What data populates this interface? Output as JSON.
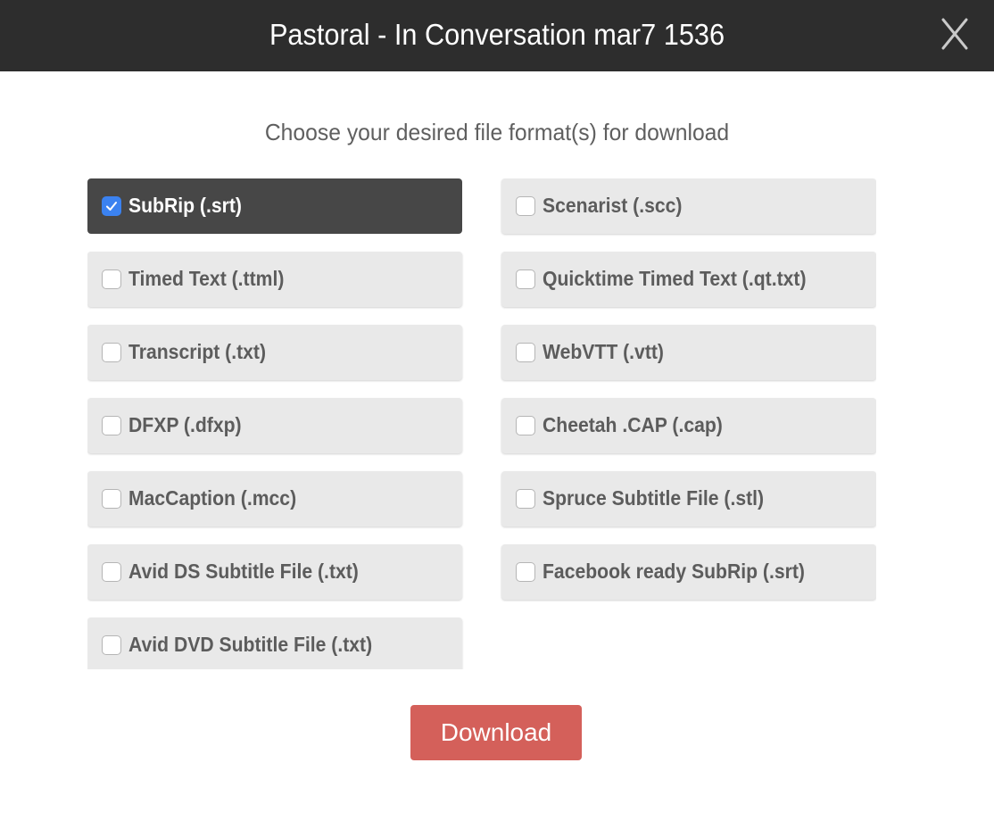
{
  "dialog": {
    "title": "Pastoral - In Conversation mar7 1536",
    "close_icon": "close-x-icon",
    "subtitle": "Choose your desired file format(s) for download"
  },
  "formats": [
    {
      "label": "SubRip (.srt)",
      "checked": true
    },
    {
      "label": "Scenarist (.scc)",
      "checked": false
    },
    {
      "label": "Timed Text (.ttml)",
      "checked": false
    },
    {
      "label": "Quicktime Timed Text (.qt.txt)",
      "checked": false
    },
    {
      "label": "Transcript (.txt)",
      "checked": false
    },
    {
      "label": "WebVTT (.vtt)",
      "checked": false
    },
    {
      "label": "DFXP (.dfxp)",
      "checked": false
    },
    {
      "label": "Cheetah .CAP (.cap)",
      "checked": false
    },
    {
      "label": "MacCaption (.mcc)",
      "checked": false
    },
    {
      "label": "Spruce Subtitle File (.stl)",
      "checked": false
    },
    {
      "label": "Avid DS Subtitle File (.txt)",
      "checked": false
    },
    {
      "label": "Facebook ready SubRip (.srt)",
      "checked": false
    },
    {
      "label": "Avid DVD Subtitle File (.txt)",
      "checked": false
    }
  ],
  "actions": {
    "download_label": "Download"
  },
  "colors": {
    "header_bg": "#2d2d2d",
    "selected_bg": "#474747",
    "item_bg": "#e9e9e9",
    "checkbox_checked": "#3b82f0",
    "download_bg": "#d4605a"
  }
}
